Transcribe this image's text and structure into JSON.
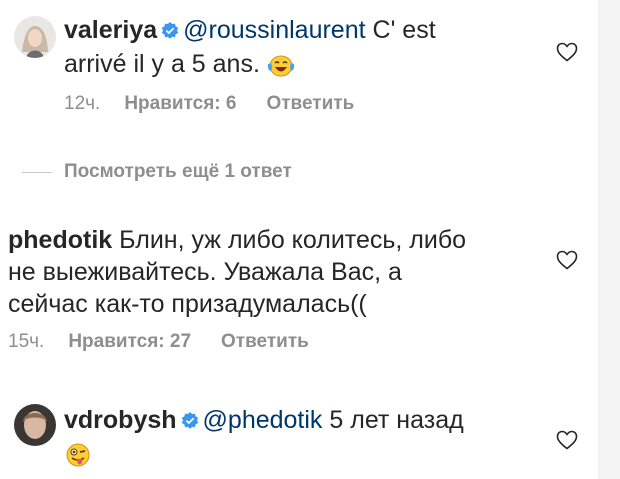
{
  "comments": [
    {
      "username": "valeriya",
      "verified": true,
      "mention": "@roussinlaurent",
      "text_line1": "C' est",
      "text_line2": "arrivé il y a  5 ans.",
      "emoji": "laughing-tears-emoji",
      "time": "12ч.",
      "likes": "Нравится: 6",
      "reply": "Ответить"
    },
    {
      "username": "phedotik",
      "verified": false,
      "text_line1": "Блин, уж либо колитесь, либо",
      "text_line2": "не выеживайтесь. Уважала Вас, а",
      "text_line3": "сейчас как-то призадумалась((",
      "time": "15ч.",
      "likes": "Нравится: 27",
      "reply": "Ответить"
    },
    {
      "username": "vdrobysh",
      "verified": true,
      "mention": "@phedotik",
      "text_line1": "5 лет назад",
      "emoji": "winking-tongue-emoji"
    }
  ],
  "view_more": "Посмотреть ещё 1 ответ",
  "colors": {
    "text": "#262626",
    "secondary": "#8e8e8e",
    "mention": "#00376b",
    "verified": "#3897f0"
  }
}
